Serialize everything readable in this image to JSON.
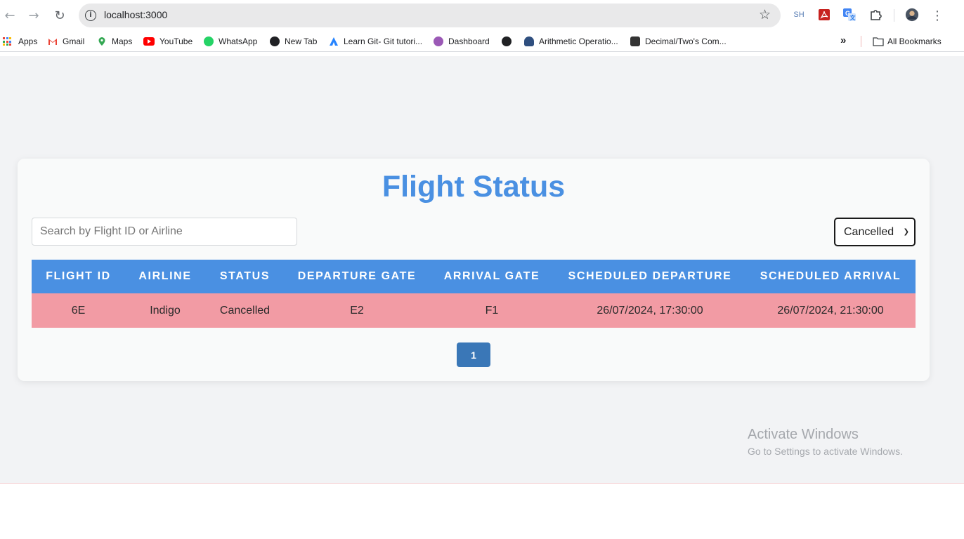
{
  "browser": {
    "url": "localhost:3000",
    "profile_initials": "SH",
    "bookmarks": [
      {
        "label": "Apps",
        "icon": "apps-grid-icon"
      },
      {
        "label": "Gmail",
        "icon": "gmail-icon",
        "color": "#ea4335"
      },
      {
        "label": "Maps",
        "icon": "maps-pin-icon",
        "color": "#34a853"
      },
      {
        "label": "YouTube",
        "icon": "youtube-icon",
        "color": "#ff0000"
      },
      {
        "label": "WhatsApp",
        "icon": "whatsapp-icon",
        "color": "#25d366"
      },
      {
        "label": "New Tab",
        "icon": "globe-icon",
        "color": "#202124"
      },
      {
        "label": "Learn Git- Git tutori...",
        "icon": "atlassian-icon",
        "color": "#2684ff"
      },
      {
        "label": "Dashboard",
        "icon": "dashboard-icon",
        "color": "#9b59b6"
      },
      {
        "label": "",
        "icon": "globe-icon",
        "color": "#202124"
      },
      {
        "label": "Arithmetic Operatio...",
        "icon": "geek-icon",
        "color": "#2f4f7f"
      },
      {
        "label": "Decimal/Two's Com...",
        "icon": "calculator-icon",
        "color": "#333333"
      }
    ],
    "all_bookmarks_label": "All Bookmarks"
  },
  "app": {
    "title": "Flight Status",
    "search_placeholder": "Search by Flight ID or Airline",
    "status_filter": "Cancelled",
    "columns": [
      "FLIGHT ID",
      "AIRLINE",
      "STATUS",
      "DEPARTURE GATE",
      "ARRIVAL GATE",
      "SCHEDULED DEPARTURE",
      "SCHEDULED ARRIVAL"
    ],
    "rows": [
      [
        "6E",
        "Indigo",
        "Cancelled",
        "E2",
        "F1",
        "26/07/2024, 17:30:00",
        "26/07/2024, 21:30:00"
      ]
    ],
    "current_page": "1",
    "colors": {
      "accent": "#4a90e2",
      "cancelled_row": "#f29ba4",
      "pagination": "#3a77b7"
    }
  },
  "os_watermark": {
    "line1": "Activate Windows",
    "line2": "Go to Settings to activate Windows."
  }
}
